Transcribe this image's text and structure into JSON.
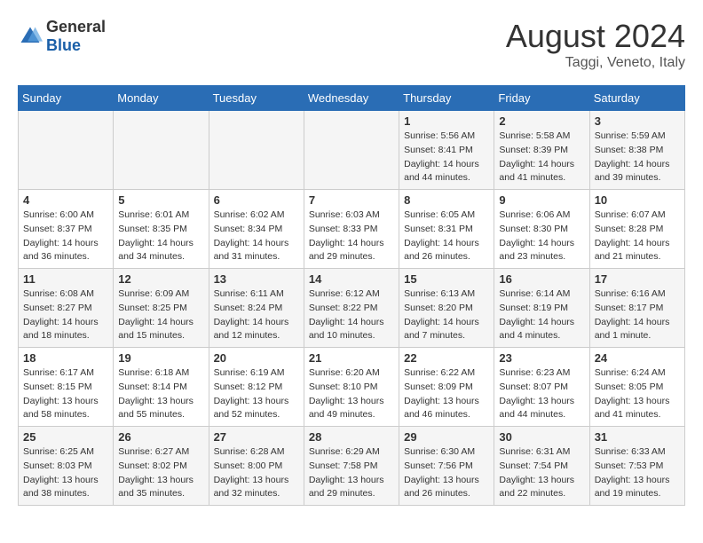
{
  "logo": {
    "text_general": "General",
    "text_blue": "Blue"
  },
  "title": "August 2024",
  "subtitle": "Taggi, Veneto, Italy",
  "days_of_week": [
    "Sunday",
    "Monday",
    "Tuesday",
    "Wednesday",
    "Thursday",
    "Friday",
    "Saturday"
  ],
  "weeks": [
    [
      {
        "day": "",
        "info": ""
      },
      {
        "day": "",
        "info": ""
      },
      {
        "day": "",
        "info": ""
      },
      {
        "day": "",
        "info": ""
      },
      {
        "day": "1",
        "info": "Sunrise: 5:56 AM\nSunset: 8:41 PM\nDaylight: 14 hours and 44 minutes."
      },
      {
        "day": "2",
        "info": "Sunrise: 5:58 AM\nSunset: 8:39 PM\nDaylight: 14 hours and 41 minutes."
      },
      {
        "day": "3",
        "info": "Sunrise: 5:59 AM\nSunset: 8:38 PM\nDaylight: 14 hours and 39 minutes."
      }
    ],
    [
      {
        "day": "4",
        "info": "Sunrise: 6:00 AM\nSunset: 8:37 PM\nDaylight: 14 hours and 36 minutes."
      },
      {
        "day": "5",
        "info": "Sunrise: 6:01 AM\nSunset: 8:35 PM\nDaylight: 14 hours and 34 minutes."
      },
      {
        "day": "6",
        "info": "Sunrise: 6:02 AM\nSunset: 8:34 PM\nDaylight: 14 hours and 31 minutes."
      },
      {
        "day": "7",
        "info": "Sunrise: 6:03 AM\nSunset: 8:33 PM\nDaylight: 14 hours and 29 minutes."
      },
      {
        "day": "8",
        "info": "Sunrise: 6:05 AM\nSunset: 8:31 PM\nDaylight: 14 hours and 26 minutes."
      },
      {
        "day": "9",
        "info": "Sunrise: 6:06 AM\nSunset: 8:30 PM\nDaylight: 14 hours and 23 minutes."
      },
      {
        "day": "10",
        "info": "Sunrise: 6:07 AM\nSunset: 8:28 PM\nDaylight: 14 hours and 21 minutes."
      }
    ],
    [
      {
        "day": "11",
        "info": "Sunrise: 6:08 AM\nSunset: 8:27 PM\nDaylight: 14 hours and 18 minutes."
      },
      {
        "day": "12",
        "info": "Sunrise: 6:09 AM\nSunset: 8:25 PM\nDaylight: 14 hours and 15 minutes."
      },
      {
        "day": "13",
        "info": "Sunrise: 6:11 AM\nSunset: 8:24 PM\nDaylight: 14 hours and 12 minutes."
      },
      {
        "day": "14",
        "info": "Sunrise: 6:12 AM\nSunset: 8:22 PM\nDaylight: 14 hours and 10 minutes."
      },
      {
        "day": "15",
        "info": "Sunrise: 6:13 AM\nSunset: 8:20 PM\nDaylight: 14 hours and 7 minutes."
      },
      {
        "day": "16",
        "info": "Sunrise: 6:14 AM\nSunset: 8:19 PM\nDaylight: 14 hours and 4 minutes."
      },
      {
        "day": "17",
        "info": "Sunrise: 6:16 AM\nSunset: 8:17 PM\nDaylight: 14 hours and 1 minute."
      }
    ],
    [
      {
        "day": "18",
        "info": "Sunrise: 6:17 AM\nSunset: 8:15 PM\nDaylight: 13 hours and 58 minutes."
      },
      {
        "day": "19",
        "info": "Sunrise: 6:18 AM\nSunset: 8:14 PM\nDaylight: 13 hours and 55 minutes."
      },
      {
        "day": "20",
        "info": "Sunrise: 6:19 AM\nSunset: 8:12 PM\nDaylight: 13 hours and 52 minutes."
      },
      {
        "day": "21",
        "info": "Sunrise: 6:20 AM\nSunset: 8:10 PM\nDaylight: 13 hours and 49 minutes."
      },
      {
        "day": "22",
        "info": "Sunrise: 6:22 AM\nSunset: 8:09 PM\nDaylight: 13 hours and 46 minutes."
      },
      {
        "day": "23",
        "info": "Sunrise: 6:23 AM\nSunset: 8:07 PM\nDaylight: 13 hours and 44 minutes."
      },
      {
        "day": "24",
        "info": "Sunrise: 6:24 AM\nSunset: 8:05 PM\nDaylight: 13 hours and 41 minutes."
      }
    ],
    [
      {
        "day": "25",
        "info": "Sunrise: 6:25 AM\nSunset: 8:03 PM\nDaylight: 13 hours and 38 minutes."
      },
      {
        "day": "26",
        "info": "Sunrise: 6:27 AM\nSunset: 8:02 PM\nDaylight: 13 hours and 35 minutes."
      },
      {
        "day": "27",
        "info": "Sunrise: 6:28 AM\nSunset: 8:00 PM\nDaylight: 13 hours and 32 minutes."
      },
      {
        "day": "28",
        "info": "Sunrise: 6:29 AM\nSunset: 7:58 PM\nDaylight: 13 hours and 29 minutes."
      },
      {
        "day": "29",
        "info": "Sunrise: 6:30 AM\nSunset: 7:56 PM\nDaylight: 13 hours and 26 minutes."
      },
      {
        "day": "30",
        "info": "Sunrise: 6:31 AM\nSunset: 7:54 PM\nDaylight: 13 hours and 22 minutes."
      },
      {
        "day": "31",
        "info": "Sunrise: 6:33 AM\nSunset: 7:53 PM\nDaylight: 13 hours and 19 minutes."
      }
    ]
  ]
}
